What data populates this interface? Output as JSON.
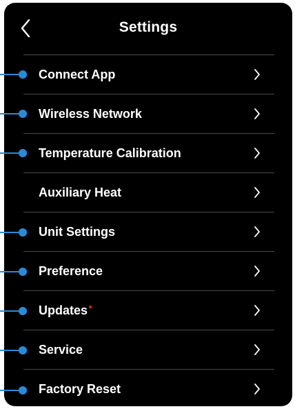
{
  "header": {
    "title": "Settings",
    "back_icon": "chevron-left-icon"
  },
  "colors": {
    "background": "#000000",
    "text": "#ffffff",
    "divider": "#4a4a4a",
    "callout": "#2a8ad8",
    "badge": "#e02020"
  },
  "menu": {
    "items": [
      {
        "label": "Connect App",
        "has_callout": true,
        "has_badge": false
      },
      {
        "label": "Wireless Network",
        "has_callout": true,
        "has_badge": false
      },
      {
        "label": "Temperature Calibration",
        "has_callout": true,
        "has_badge": false
      },
      {
        "label": "Auxiliary Heat",
        "has_callout": false,
        "has_badge": false
      },
      {
        "label": "Unit Settings",
        "has_callout": true,
        "has_badge": false
      },
      {
        "label": "Preference",
        "has_callout": true,
        "has_badge": false
      },
      {
        "label": "Updates",
        "has_callout": true,
        "has_badge": true
      },
      {
        "label": "Service",
        "has_callout": true,
        "has_badge": false
      },
      {
        "label": "Factory Reset",
        "has_callout": true,
        "has_badge": false
      }
    ],
    "chevron_icon": "chevron-right-icon"
  }
}
